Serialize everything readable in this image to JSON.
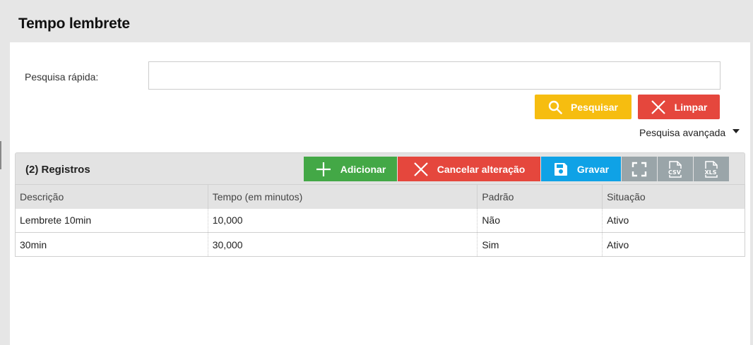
{
  "page": {
    "title": "Tempo lembrete"
  },
  "search": {
    "label": "Pesquisa rápida:",
    "value": "",
    "placeholder": "",
    "search_button": "Pesquisar",
    "clear_button": "Limpar",
    "advanced_link": "Pesquisa avançada"
  },
  "grid": {
    "records_label": "(2) Registros",
    "toolbar": {
      "add": "Adicionar",
      "cancel": "Cancelar alteração",
      "save": "Gravar",
      "icons": [
        "fullscreen-icon",
        "csv-export-icon",
        "xls-export-icon"
      ]
    },
    "columns": [
      "Descrição",
      "Tempo (em minutos)",
      "Padrão",
      "Situação"
    ],
    "rows": [
      [
        "Lembrete 10min",
        "10,000",
        "Não",
        "Ativo"
      ],
      [
        "30min",
        "30,000",
        "Sim",
        "Ativo"
      ]
    ]
  },
  "colors": {
    "search": "#f6bd10",
    "clear": "#e5473d",
    "add": "#43a846",
    "cancel": "#e5473d",
    "save": "#0fa2e6",
    "export": "#9aa5a9"
  }
}
